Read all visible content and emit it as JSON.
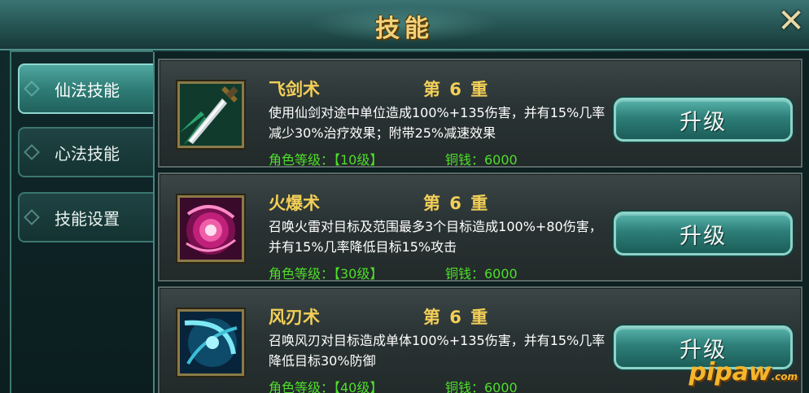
{
  "header": {
    "title": "技能",
    "close_icon": "close-icon"
  },
  "sidebar": {
    "tabs": [
      {
        "label": "仙法技能",
        "active": true
      },
      {
        "label": "心法技能",
        "active": false
      },
      {
        "label": "技能设置",
        "active": false
      }
    ]
  },
  "skills": [
    {
      "name": "飞剑术",
      "level": "第 6 重",
      "desc": "使用仙剑对途中单位造成100%+135伤害，并有15%几率减少30%治疗效果；附带25%减速效果",
      "req_level": "角色等级：【10级】",
      "cost": "铜钱：6000",
      "button": "升级",
      "icon": "flying-sword-icon"
    },
    {
      "name": "火爆术",
      "level": "第 6 重",
      "desc": "召唤火雷对目标及范围最多3个目标造成100%+80伤害，并有15%几率降低目标15%攻击",
      "req_level": "角色等级：【30级】",
      "cost": "铜钱：6000",
      "button": "升级",
      "icon": "fire-burst-icon"
    },
    {
      "name": "风刃术",
      "level": "第 6 重",
      "desc": "召唤风刃对目标造成单体100%+135伤害，并有15%几率降低目标30%防御",
      "req_level": "角色等级：【40级】",
      "cost": "铜钱：6000",
      "button": "升级",
      "icon": "wind-blade-icon"
    }
  ],
  "watermark": {
    "text": "pipaw",
    "suffix": ".com"
  },
  "colors": {
    "title": "#f1d27a",
    "skill_name": "#f3cf57",
    "requirement": "#4fde2b",
    "button": "#2d7e78"
  }
}
